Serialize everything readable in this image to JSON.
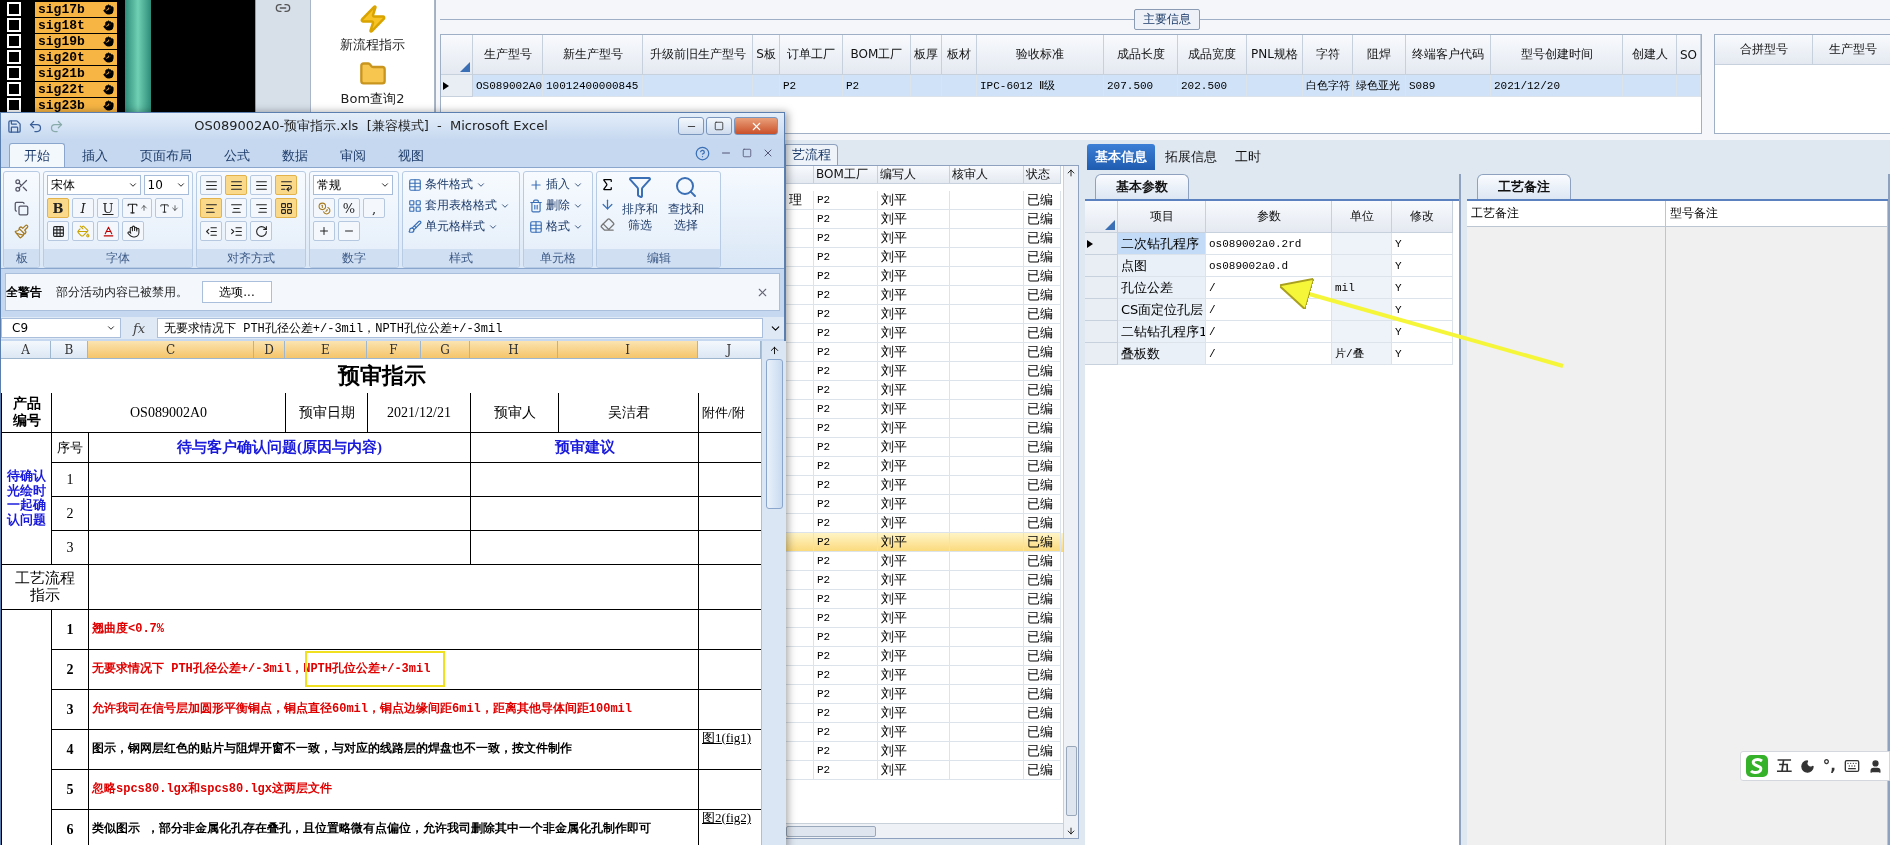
{
  "layers": [
    {
      "label": "sig17b",
      "checked": false
    },
    {
      "label": "sig18t",
      "checked": false
    },
    {
      "label": "sig19b",
      "checked": false
    },
    {
      "label": "sig20t",
      "checked": false
    },
    {
      "label": "sig21b",
      "checked": false
    },
    {
      "label": "sig22t",
      "checked": false
    },
    {
      "label": "sig23b",
      "checked": false
    }
  ],
  "launcher": [
    {
      "label": "新流程指示",
      "kind": "bolt"
    },
    {
      "label": "Bom查询2",
      "kind": "folder"
    }
  ],
  "main_info": {
    "title": "主要信息",
    "columns": [
      "生产型号",
      "新生产型号",
      "升级前旧生产型号",
      "S板",
      "订单工厂",
      "BOM工厂",
      "板厚",
      "板材",
      "验收标准",
      "成品长度",
      "成品宽度",
      "PNL规格",
      "字符",
      "阻焊",
      "终端客户代码",
      "型号创建时间",
      "创建人",
      "SO"
    ],
    "rows": [
      {
        "selected": true,
        "cells": [
          "OS089002A0",
          "10012400000845",
          null,
          null,
          "P2",
          "P2",
          null,
          null,
          "IPC-6012 Ⅱ级",
          "207.500",
          "202.500",
          null,
          "白色字符",
          "绿色亚光",
          "S089",
          "2021/12/20",
          null,
          null
        ]
      }
    ]
  },
  "merge_table": {
    "columns": [
      "合拼型号",
      "生产型号"
    ]
  },
  "process": {
    "tab": "艺流程",
    "columns": [
      null,
      "BOM工厂",
      "编写人",
      "核审人",
      "状态"
    ],
    "rows": [
      {
        "selected": false,
        "cells": [
          "理",
          "P2",
          "刘平",
          null,
          "已编"
        ]
      },
      {
        "selected": false,
        "cells": [
          null,
          "P2",
          "刘平",
          null,
          "已编"
        ]
      },
      {
        "selected": false,
        "cells": [
          null,
          "P2",
          "刘平",
          null,
          "已编"
        ]
      },
      {
        "selected": false,
        "cells": [
          null,
          "P2",
          "刘平",
          null,
          "已编"
        ]
      },
      {
        "selected": false,
        "cells": [
          null,
          "P2",
          "刘平",
          null,
          "已编"
        ]
      },
      {
        "selected": false,
        "cells": [
          null,
          "P2",
          "刘平",
          null,
          "已编"
        ]
      },
      {
        "selected": false,
        "cells": [
          null,
          "P2",
          "刘平",
          null,
          "已编"
        ]
      },
      {
        "selected": false,
        "cells": [
          null,
          "P2",
          "刘平",
          null,
          "已编"
        ]
      },
      {
        "selected": false,
        "cells": [
          null,
          "P2",
          "刘平",
          null,
          "已编"
        ]
      },
      {
        "selected": false,
        "cells": [
          null,
          "P2",
          "刘平",
          null,
          "已编"
        ]
      },
      {
        "selected": false,
        "cells": [
          null,
          "P2",
          "刘平",
          null,
          "已编"
        ]
      },
      {
        "selected": false,
        "cells": [
          null,
          "P2",
          "刘平",
          null,
          "已编"
        ]
      },
      {
        "selected": false,
        "cells": [
          null,
          "P2",
          "刘平",
          null,
          "已编"
        ]
      },
      {
        "selected": false,
        "cells": [
          null,
          "P2",
          "刘平",
          null,
          "已编"
        ]
      },
      {
        "selected": false,
        "cells": [
          null,
          "P2",
          "刘平",
          null,
          "已编"
        ]
      },
      {
        "selected": false,
        "cells": [
          null,
          "P2",
          "刘平",
          null,
          "已编"
        ]
      },
      {
        "selected": false,
        "cells": [
          null,
          "P2",
          "刘平",
          null,
          "已编"
        ]
      },
      {
        "selected": false,
        "cells": [
          null,
          "P2",
          "刘平",
          null,
          "已编"
        ]
      },
      {
        "selected": true,
        "cells": [
          null,
          "P2",
          "刘平",
          null,
          "已编"
        ]
      },
      {
        "selected": false,
        "cells": [
          null,
          "P2",
          "刘平",
          null,
          "已编"
        ]
      },
      {
        "selected": false,
        "cells": [
          null,
          "P2",
          "刘平",
          null,
          "已编"
        ]
      },
      {
        "selected": false,
        "cells": [
          null,
          "P2",
          "刘平",
          null,
          "已编"
        ]
      },
      {
        "selected": false,
        "cells": [
          null,
          "P2",
          "刘平",
          null,
          "已编"
        ]
      },
      {
        "selected": false,
        "cells": [
          null,
          "P2",
          "刘平",
          null,
          "已编"
        ]
      },
      {
        "selected": false,
        "cells": [
          null,
          "P2",
          "刘平",
          null,
          "已编"
        ]
      },
      {
        "selected": false,
        "cells": [
          null,
          "P2",
          "刘平",
          null,
          "已编"
        ]
      },
      {
        "selected": false,
        "cells": [
          null,
          "P2",
          "刘平",
          null,
          "已编"
        ]
      },
      {
        "selected": false,
        "cells": [
          null,
          "P2",
          "刘平",
          null,
          "已编"
        ]
      },
      {
        "selected": false,
        "cells": [
          null,
          "P2",
          "刘平",
          null,
          "已编"
        ]
      },
      {
        "selected": false,
        "cells": [
          null,
          "P2",
          "刘平",
          null,
          "已编"
        ]
      },
      {
        "selected": false,
        "cells": [
          null,
          "P2",
          "刘平",
          null,
          "已编"
        ]
      }
    ]
  },
  "detail": {
    "tabs": [
      {
        "label": "基本信息",
        "selected": true
      },
      {
        "label": "拓展信息",
        "selected": false
      },
      {
        "label": "工时",
        "selected": false
      }
    ],
    "params": {
      "tab": "基本参数",
      "columns": [
        "项目",
        "参数",
        "单位",
        "修改"
      ],
      "rows": [
        {
          "selected": true,
          "cells": [
            "二次钻孔程序",
            "os089002a0.2rd",
            null,
            "Y"
          ]
        },
        {
          "selected": false,
          "cells": [
            "点图",
            "os089002a0.d",
            null,
            "Y"
          ]
        },
        {
          "selected": false,
          "cells": [
            "孔位公差",
            "/",
            "mil",
            "Y"
          ]
        },
        {
          "selected": false,
          "cells": [
            "CS面定位孔层",
            "/",
            null,
            "Y"
          ]
        },
        {
          "selected": false,
          "cells": [
            "二钻钻孔程序1",
            "/",
            null,
            "Y"
          ]
        },
        {
          "selected": false,
          "cells": [
            "叠板数",
            "/",
            "片/叠",
            "Y"
          ]
        }
      ]
    },
    "notes": {
      "tab": "工艺备注",
      "columns": [
        "工艺备注",
        "型号备注"
      ]
    }
  },
  "ime": [
    {
      "kind": "logo"
    },
    {
      "kind": "text",
      "label": "五"
    },
    {
      "kind": "moon"
    },
    {
      "kind": "text",
      "label": "°,"
    },
    {
      "kind": "keyboard"
    },
    {
      "kind": "user"
    }
  ],
  "excel": {
    "title": "OS089002A0-预审指示.xls  [兼容模式]  -  Microsoft Excel",
    "tabs": [
      {
        "label": "开始",
        "selected": true
      },
      {
        "label": "插入",
        "selected": false
      },
      {
        "label": "页面布局",
        "selected": false
      },
      {
        "label": "公式",
        "selected": false
      },
      {
        "label": "数据",
        "selected": false
      },
      {
        "label": "审阅",
        "selected": false
      },
      {
        "label": "视图",
        "selected": false
      }
    ],
    "groups": [
      {
        "kind": "clipboard",
        "label": "板"
      },
      {
        "kind": "font",
        "label": "字体",
        "font": "宋体",
        "size": "10",
        "buttons": [
          "B",
          "I",
          "U"
        ]
      },
      {
        "kind": "align",
        "label": "对齐方式"
      },
      {
        "kind": "number",
        "label": "数字",
        "format": "常规",
        "buttons": [
          "%",
          ","
        ]
      },
      {
        "kind": "style",
        "label": "样式",
        "commands": [
          "条件格式",
          "套用表格格式",
          "单元格样式"
        ]
      },
      {
        "kind": "cells",
        "label": "单元格",
        "commands": [
          "插入",
          "删除",
          "格式"
        ]
      },
      {
        "kind": "edit",
        "label": "编辑",
        "commands": [
          "排序和筛选",
          "查找和选择"
        ]
      }
    ],
    "security": {
      "label": "全警告",
      "message": "部分活动内容已被禁用。",
      "button": "选项..."
    },
    "formula": {
      "cell": "C9",
      "fx": "fx",
      "value": "无要求情况下 PTH孔径公差+/-3mil，NPTH孔位公差+/-3mil"
    },
    "columns": [
      {
        "label": "A",
        "selected": false
      },
      {
        "label": "B",
        "selected": false
      },
      {
        "label": "C",
        "selected": true
      },
      {
        "label": "D",
        "selected": true
      },
      {
        "label": "E",
        "selected": true
      },
      {
        "label": "F",
        "selected": true
      },
      {
        "label": "G",
        "selected": true
      },
      {
        "label": "H",
        "selected": true
      },
      {
        "label": "I",
        "selected": true
      },
      {
        "label": "J",
        "selected": false
      }
    ],
    "sheet": {
      "title": "预审指示",
      "product_label": "产品编号",
      "product": "OS089002A0",
      "date_label": "预审日期",
      "date": "2021/12/21",
      "reviewer_label": "预审人",
      "reviewer": "吴洁君",
      "attachment_label": "附件/附",
      "confirm_label": "待确认光绘时一起确认问题",
      "no_label": "序号",
      "question_header": "待与客户确认问题(原因与内容)",
      "advice_header": "预审建议",
      "questions": [
        "1",
        "2",
        "3"
      ],
      "flow_label": "工艺流程指示",
      "instructions": [
        {
          "no": "1",
          "text": "翘曲度<0.7%",
          "color": "#e00000"
        },
        {
          "no": "2",
          "text": "无要求情况下 PTH孔径公差+/-3mil，NPTH孔位公差+/-3mil",
          "color": "#e00000"
        },
        {
          "no": "3",
          "text": "允许我司在信号层加圆形平衡铜点，铜点直径60mil，铜点边缘间距6mil，距离其他导体间距100mil",
          "color": "#e00000"
        },
        {
          "no": "4",
          "text": "图示，钢网层红色的贴片与阻焊开窗不一致，与对应的线路层的焊盘也不一致，按文件制作",
          "color": "#000000",
          "attachment": "图1(fig1)"
        },
        {
          "no": "5",
          "text": "忽略spcs80.lgx和spcs80.lgx这两层文件",
          "color": "#e00000"
        },
        {
          "no": "6",
          "text": "类似图示 ，部分非金属化孔存在叠孔，且位置略微有点偏位，允许我司删除其中一个非金属化孔制作即可",
          "color": "#000000",
          "attachment": "图2(fig2)"
        }
      ]
    }
  }
}
